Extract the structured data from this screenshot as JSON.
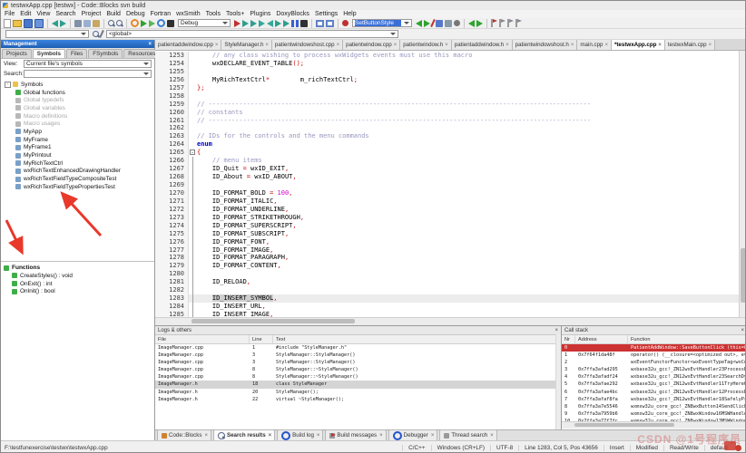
{
  "window": {
    "title": "testwxApp.cpp [testwx] - Code::Blocks svn build"
  },
  "menu": {
    "items": [
      "File",
      "Edit",
      "View",
      "Search",
      "Project",
      "Build",
      "Debug",
      "Fortran",
      "wxSmith",
      "Tools",
      "Tools+",
      "Plugins",
      "DoxyBlocks",
      "Settings",
      "Help"
    ]
  },
  "toolbar": {
    "build_target_value": "Debug",
    "symbol_combo_value": "SetButtonStyle",
    "cc_symbol_value": "",
    "scope_combo_value": "<global>",
    "main_icons": [
      {
        "n": "new-file-icon",
        "k": "page"
      },
      {
        "n": "open-file-icon",
        "k": "folder"
      },
      {
        "n": "save-icon",
        "k": "floppy",
        "c": "#4a77cc"
      },
      {
        "n": "save-all-icon",
        "k": "floppy",
        "c": "#6a92dd"
      },
      {
        "n": "sep",
        "k": "sep"
      },
      {
        "n": "undo-icon",
        "k": "arrl",
        "c": "#2f9e8f"
      },
      {
        "n": "redo-icon",
        "k": "arrr",
        "c": "#2f9e8f"
      },
      {
        "n": "sep",
        "k": "sep"
      },
      {
        "n": "cut-icon",
        "k": "sq",
        "c": "#8090a8"
      },
      {
        "n": "copy-icon",
        "k": "sq",
        "c": "#9ab0d0"
      },
      {
        "n": "paste-icon",
        "k": "sq",
        "c": "#c8a860"
      },
      {
        "n": "sep",
        "k": "sep"
      },
      {
        "n": "find-icon",
        "k": "mag",
        "c": "#556688"
      },
      {
        "n": "find-in-files-icon",
        "k": "mag",
        "c": "#556688"
      },
      {
        "n": "sep",
        "k": "sep"
      },
      {
        "n": "build-icon",
        "k": "circ",
        "c": "#e8872a"
      },
      {
        "n": "run-icon",
        "k": "tri",
        "c": "#2fa32f"
      },
      {
        "n": "build-and-run-icon",
        "k": "tri",
        "c": "#58b858"
      },
      {
        "n": "rebuild-icon",
        "k": "circ",
        "c": "#3a7fd0"
      },
      {
        "n": "abort-build-icon",
        "k": "sq",
        "c": "#303030"
      }
    ],
    "debug_icons": [
      {
        "n": "debug-continue-icon",
        "k": "tri",
        "c": "#c03030"
      },
      {
        "n": "run-to-cursor-icon",
        "k": "arrr",
        "c": "#2f9e8f"
      },
      {
        "n": "next-line-icon",
        "k": "arrr",
        "c": "#2f9e8f"
      },
      {
        "n": "step-into-icon",
        "k": "arrr",
        "c": "#35a89a"
      },
      {
        "n": "step-out-icon",
        "k": "arrl",
        "c": "#35a89a"
      },
      {
        "n": "next-instruction-icon",
        "k": "arrr",
        "c": "#2f9e8f"
      },
      {
        "n": "step-into-instruction-icon",
        "k": "arrr",
        "c": "#2f9e8f"
      },
      {
        "n": "break-debugger-icon",
        "k": "bars",
        "c": "#3a5fd0"
      },
      {
        "n": "stop-debugger-icon",
        "k": "sq",
        "c": "#303030"
      },
      {
        "n": "sep",
        "k": "sep"
      },
      {
        "n": "debugging-windows-icon",
        "k": "win",
        "c": "#6080c8"
      },
      {
        "n": "various-info-icon",
        "k": "win",
        "c": "#6080c8"
      },
      {
        "n": "sep",
        "k": "sep"
      },
      {
        "n": "stop-icon",
        "k": "dot",
        "c": "#c03030"
      }
    ],
    "incremental_icons": [
      {
        "n": "search-prev-icon",
        "k": "arrl",
        "c": "#2fa32f"
      },
      {
        "n": "search-next-icon",
        "k": "arrr",
        "c": "#2fa32f"
      },
      {
        "n": "highlight-occurrences-icon",
        "k": "slash",
        "c": "#c03030"
      },
      {
        "n": "selected-text-icon",
        "k": "sq",
        "c": "#5577cc"
      },
      {
        "n": "match-case-icon",
        "k": "sq",
        "c": "#8899aa"
      },
      {
        "n": "match-word-icon",
        "k": "dot",
        "c": "#777777"
      }
    ],
    "browse_icons": [
      {
        "n": "browse-back-icon",
        "k": "arrl",
        "c": "#2fa32f"
      },
      {
        "n": "browse-forward-icon",
        "k": "arrr",
        "c": "#2fa32f"
      },
      {
        "n": "sep",
        "k": "sep"
      },
      {
        "n": "toggle-bookmark-icon",
        "k": "flag",
        "c": "#c03030"
      },
      {
        "n": "prev-bookmark-icon",
        "k": "flag",
        "c": "#888899"
      },
      {
        "n": "next-bookmark-icon",
        "k": "flag",
        "c": "#888899"
      },
      {
        "n": "clear-bookmarks-icon",
        "k": "flag",
        "c": "#888899"
      }
    ],
    "row2_icons": [
      {
        "n": "goto-declaration-icon",
        "k": "mag",
        "c": "#556688"
      },
      {
        "n": "cc-settings-icon",
        "k": "slash",
        "c": "#777788"
      }
    ]
  },
  "management": {
    "title": "Management",
    "close_label": "×",
    "tabs": [
      "Projects",
      "Symbols",
      "Files",
      "FSymbols",
      "Resources"
    ],
    "active_tab": "Symbols",
    "view_label": "View:",
    "view_value": "Current file's symbols",
    "search_label": "Search:",
    "search_value": "",
    "tree": {
      "root": "Symbols",
      "items": [
        {
          "label": "Global functions",
          "kind": "fn",
          "dim": false
        },
        {
          "label": "Global typedefs",
          "kind": "fn",
          "dim": true
        },
        {
          "label": "Global variables",
          "kind": "var",
          "dim": true
        },
        {
          "label": "Macro definitions",
          "kind": "macro",
          "dim": true
        },
        {
          "label": "Macro usages",
          "kind": "macro",
          "dim": true
        },
        {
          "label": "MyApp",
          "kind": "class",
          "dim": false
        },
        {
          "label": "MyFrame",
          "kind": "class",
          "dim": false
        },
        {
          "label": "MyFrame1",
          "kind": "class",
          "dim": false
        },
        {
          "label": "MyPrintout",
          "kind": "class",
          "dim": false
        },
        {
          "label": "MyRichTextCtrl",
          "kind": "class",
          "dim": false
        },
        {
          "label": "wxRichTextEnhancedDrawingHandler",
          "kind": "class",
          "dim": false
        },
        {
          "label": "wxRichTextFieldTypeCompositeTest",
          "kind": "class",
          "dim": false
        },
        {
          "label": "wxRichTextFieldTypePropertiesTest",
          "kind": "class",
          "dim": false
        }
      ]
    },
    "functions_panel": {
      "title": "Functions",
      "items": [
        {
          "label": "CreateStyles() : void"
        },
        {
          "label": "OnExit() : int"
        },
        {
          "label": "OnInit() : bool"
        }
      ]
    }
  },
  "editor": {
    "tabs": [
      {
        "label": "patientaddwindow.cpp",
        "active": false
      },
      {
        "label": "StyleManager.h",
        "active": false
      },
      {
        "label": "patientwindowshost.cpp",
        "active": false
      },
      {
        "label": "patientwindow.cpp",
        "active": false
      },
      {
        "label": "patientwindow.h",
        "active": false
      },
      {
        "label": "patientaddwindow.h",
        "active": false
      },
      {
        "label": "patientwindowshost.h",
        "active": false
      },
      {
        "label": "main.cpp",
        "active": false
      },
      {
        "label": "*testwxApp.cpp",
        "active": true
      },
      {
        "label": "testwxMain.cpp",
        "active": false
      }
    ],
    "close_label": "×",
    "lines": [
      {
        "n": 1253,
        "parts": [
          [
            "c",
            "    // any class wishing to process wxWidgets events must use this macro"
          ]
        ]
      },
      {
        "n": 1254,
        "parts": [
          [
            "t",
            "    wxDECLARE_EVENT_TABLE"
          ],
          [
            "o",
            "();"
          ]
        ]
      },
      {
        "n": 1255,
        "parts": []
      },
      {
        "n": 1256,
        "parts": [
          [
            "t",
            "    MyRichTextCtrl"
          ],
          [
            "o",
            "*"
          ],
          [
            "t",
            "        m_richTextCtrl"
          ],
          [
            "o",
            ";"
          ]
        ]
      },
      {
        "n": 1257,
        "parts": [
          [
            "o",
            "};"
          ]
        ]
      },
      {
        "n": 1258,
        "parts": []
      },
      {
        "n": 1259,
        "parts": [
          [
            "c",
            "// ----------------------------------------------------------------------------------------------------"
          ]
        ]
      },
      {
        "n": 1260,
        "parts": [
          [
            "c",
            "// constants"
          ]
        ]
      },
      {
        "n": 1261,
        "parts": [
          [
            "c",
            "// ----------------------------------------------------------------------------------------------------"
          ]
        ]
      },
      {
        "n": 1262,
        "parts": []
      },
      {
        "n": 1263,
        "parts": [
          [
            "c",
            "// IDs for the controls and the menu commands"
          ]
        ]
      },
      {
        "n": 1264,
        "parts": [
          [
            "k",
            "enum"
          ]
        ]
      },
      {
        "n": 1265,
        "fold": "open",
        "parts": [
          [
            "o",
            "{"
          ]
        ]
      },
      {
        "n": 1266,
        "fold": "line",
        "parts": [
          [
            "c",
            "    // menu items"
          ]
        ]
      },
      {
        "n": 1267,
        "fold": "line",
        "parts": [
          [
            "t",
            "    ID_Quit "
          ],
          [
            "o",
            "="
          ],
          [
            "t",
            " wxID_EXIT"
          ],
          [
            "o",
            ","
          ]
        ]
      },
      {
        "n": 1268,
        "fold": "line",
        "parts": [
          [
            "t",
            "    ID_About "
          ],
          [
            "o",
            "="
          ],
          [
            "t",
            " wxID_ABOUT"
          ],
          [
            "o",
            ","
          ]
        ]
      },
      {
        "n": 1269,
        "fold": "line",
        "parts": []
      },
      {
        "n": 1270,
        "fold": "line",
        "parts": [
          [
            "t",
            "    ID_FORMAT_BOLD "
          ],
          [
            "o",
            "="
          ],
          [
            "t",
            " "
          ],
          [
            "x",
            "100"
          ],
          [
            "o",
            ","
          ]
        ]
      },
      {
        "n": 1271,
        "fold": "line",
        "parts": [
          [
            "t",
            "    ID_FORMAT_ITALIC"
          ],
          [
            "o",
            ","
          ]
        ]
      },
      {
        "n": 1272,
        "fold": "line",
        "parts": [
          [
            "t",
            "    ID_FORMAT_UNDERLINE"
          ],
          [
            "o",
            ","
          ]
        ]
      },
      {
        "n": 1273,
        "fold": "line",
        "parts": [
          [
            "t",
            "    ID_FORMAT_STRIKETHROUGH"
          ],
          [
            "o",
            ","
          ]
        ]
      },
      {
        "n": 1274,
        "fold": "line",
        "parts": [
          [
            "t",
            "    ID_FORMAT_SUPERSCRIPT"
          ],
          [
            "o",
            ","
          ]
        ]
      },
      {
        "n": 1275,
        "fold": "line",
        "parts": [
          [
            "t",
            "    ID_FORMAT_SUBSCRIPT"
          ],
          [
            "o",
            ","
          ]
        ]
      },
      {
        "n": 1276,
        "fold": "line",
        "parts": [
          [
            "t",
            "    ID_FORMAT_FONT"
          ],
          [
            "o",
            ","
          ]
        ]
      },
      {
        "n": 1277,
        "fold": "line",
        "parts": [
          [
            "t",
            "    ID_FORMAT_IMAGE"
          ],
          [
            "o",
            ","
          ]
        ]
      },
      {
        "n": 1278,
        "fold": "line",
        "parts": [
          [
            "t",
            "    ID_FORMAT_PARAGRAPH"
          ],
          [
            "o",
            ","
          ]
        ]
      },
      {
        "n": 1279,
        "fold": "line",
        "parts": [
          [
            "t",
            "    ID_FORMAT_CONTENT"
          ],
          [
            "o",
            ","
          ]
        ]
      },
      {
        "n": 1280,
        "fold": "line",
        "parts": []
      },
      {
        "n": 1281,
        "fold": "line",
        "parts": [
          [
            "t",
            "    ID_RELOAD"
          ],
          [
            "o",
            ","
          ]
        ]
      },
      {
        "n": 1282,
        "fold": "line",
        "parts": []
      },
      {
        "n": 1283,
        "fold": "line",
        "current": true,
        "parts": [
          [
            "t",
            "    "
          ],
          [
            "h",
            "ID_INSERT_SYMBOL"
          ],
          [
            "o",
            ","
          ]
        ]
      },
      {
        "n": 1284,
        "fold": "line",
        "parts": [
          [
            "t",
            "    ID_INSERT_URL"
          ],
          [
            "o",
            ","
          ]
        ]
      },
      {
        "n": 1285,
        "fold": "line",
        "parts": [
          [
            "t",
            "    ID_INSERT_IMAGE"
          ],
          [
            "o",
            ","
          ]
        ]
      }
    ]
  },
  "logs": {
    "title": "Logs & others",
    "close_label": "×",
    "columns": [
      "File",
      "Line",
      "Text"
    ],
    "selected_row": 5,
    "rows": [
      [
        "ImageManager.cpp",
        "1",
        "#include \"StyleManager.h\""
      ],
      [
        "ImageManager.cpp",
        "3",
        "StyleManager::StyleManager()"
      ],
      [
        "ImageManager.cpp",
        "3",
        "StyleManager::StyleManager()"
      ],
      [
        "ImageManager.cpp",
        "8",
        "StyleManager::~StyleManager()"
      ],
      [
        "ImageManager.cpp",
        "8",
        "StyleManager::~StyleManager()"
      ],
      [
        "ImageManager.h",
        "18",
        "class StyleManager"
      ],
      [
        "ImageManager.h",
        "20",
        "StyleManager();"
      ],
      [
        "ImageManager.h",
        "22",
        "virtual ~StyleManager();"
      ]
    ]
  },
  "callstack": {
    "title": "Call stack",
    "close_label": "×",
    "columns": [
      "Nr",
      "Address",
      "Function"
    ],
    "active_row": 0,
    "rows": [
      [
        "0",
        "",
        "PatientAddWindow::SaveButtonClick (this=0x7234350"
      ],
      [
        "1",
        "0x7f64f1da48f",
        "operator() (__closure=<optimized out>, event=...)"
      ],
      [
        "2",
        "",
        "wxEventFunctorFunctor<wxEventTypeTag<wxComma"
      ],
      [
        "3",
        "0x7ffa3afad295",
        "wxbase32u_gcc!_ZN12wxEvtHandler23ProcessEventIf"
      ],
      [
        "4",
        "0x7ffa3afadf24",
        "wxbase32u_gcc!_ZN12wxEvtHandler23SearchDynami"
      ],
      [
        "5",
        "0x7ffa3afae292",
        "wxbase32u_gcc!_ZN12wxEvtHandler11TryHereOnlyEf"
      ],
      [
        "6",
        "0x7ffa3afae4bc",
        "wxbase32u_gcc!_ZN12wxEvtHandler12ProcessEventL"
      ],
      [
        "7",
        "0x7ffa3afaf8fa",
        "wxbase32u_gcc!_ZN12wxEvtHandler18SafelyProcessE"
      ],
      [
        "8",
        "0x7ffa3a7e5546",
        "wxmsw32u_core_gcc!_ZN8wxButton14SendClickEvent"
      ],
      [
        "9",
        "0x7ffa3a7959b6",
        "wxmsw32u_core_gcc!_ZN8wxWindow16MSWHandleM"
      ],
      [
        "10",
        "0x7ffa3a77f7fc",
        "wxmsw32u_core_gcc!_ZN8wxWindow13MSWWindow"
      ]
    ]
  },
  "bottom_tabs": {
    "close_label": "×",
    "items": [
      {
        "label": "Code::Blocks",
        "active": false,
        "icon": {
          "n": "codeblocks-icon",
          "k": "sq",
          "c": "#d08030"
        }
      },
      {
        "label": "Search results",
        "active": true,
        "icon": {
          "n": "search-results-icon",
          "k": "mag",
          "c": "#556688"
        }
      },
      {
        "label": "Build log",
        "active": false,
        "icon": {
          "n": "build-log-icon",
          "k": "circ",
          "c": "#2255cc"
        }
      },
      {
        "label": "Build messages",
        "active": false,
        "icon": {
          "n": "build-messages-icon",
          "k": "flag",
          "c": "#c03030"
        }
      },
      {
        "label": "Debugger",
        "active": false,
        "icon": {
          "n": "debugger-icon",
          "k": "circ",
          "c": "#2255cc"
        }
      },
      {
        "label": "Thread search",
        "active": false,
        "icon": {
          "n": "thread-search-icon",
          "k": "sq",
          "c": "#999999"
        }
      }
    ]
  },
  "statusbar": {
    "file_path": "F:\\testfunexercise\\testwx\\testwxApp.cpp",
    "language": "C/C++",
    "eol": "Windows (CR+LF)",
    "encoding": "UTF-8",
    "position": "Line 1283, Col 5, Pos 43656",
    "insert_mode": "Insert",
    "modified": "Modified",
    "readwrite": "Read/Write",
    "profile": "default"
  },
  "watermark": "CSDN @1号程序员",
  "colors": {
    "management_header_blue": "#2a6fd0",
    "selection_blue": "#3a6fd8",
    "active_frame_red": "#cc3333",
    "annotation_arrow_red": "#e8392b",
    "comment": "#9898c0",
    "keyword": "#0000c8",
    "operator": "#d00000",
    "number": "#d000d0"
  }
}
